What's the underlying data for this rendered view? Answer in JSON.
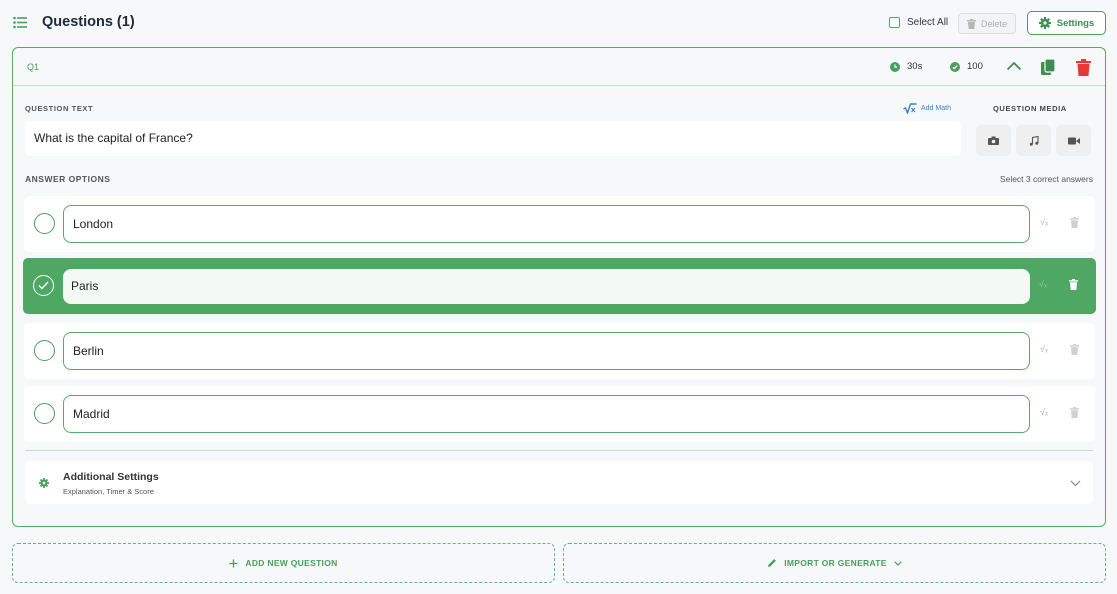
{
  "header": {
    "title": "Questions (1)",
    "select_all": "Select All",
    "delete": "Delete",
    "settings": "Settings"
  },
  "question": {
    "number": "Q1",
    "time": "30s",
    "points": "100",
    "text_label": "QUESTION TEXT",
    "add_math": "Add Math",
    "media_label": "QUESTION MEDIA",
    "text": "What is the capital of France?",
    "answers_label": "ANSWER OPTIONS",
    "answers_hint": "Select 3 correct answers",
    "options": [
      {
        "text": "London",
        "correct": false
      },
      {
        "text": "Paris",
        "correct": true
      },
      {
        "text": "Berlin",
        "correct": false
      },
      {
        "text": "Madrid",
        "correct": false
      }
    ],
    "additional_title": "Additional Settings",
    "additional_sub": "Explanation, Timer & Score"
  },
  "footer": {
    "add_new": "ADD NEW QUESTION",
    "import": "IMPORT OR GENERATE"
  },
  "colors": {
    "accent": "#4a9e5c",
    "correct_bg": "#4ea864",
    "danger": "#e53935",
    "link": "#3b82c4"
  },
  "icons": [
    "list-icon",
    "trash-icon",
    "gear-icon",
    "clock-icon",
    "check-circle-icon",
    "chevron-up-icon",
    "copy-icon",
    "sqrt-icon",
    "camera-icon",
    "music-icon",
    "video-icon",
    "check-icon",
    "chevron-down-icon",
    "plus-icon",
    "pencil-icon"
  ]
}
